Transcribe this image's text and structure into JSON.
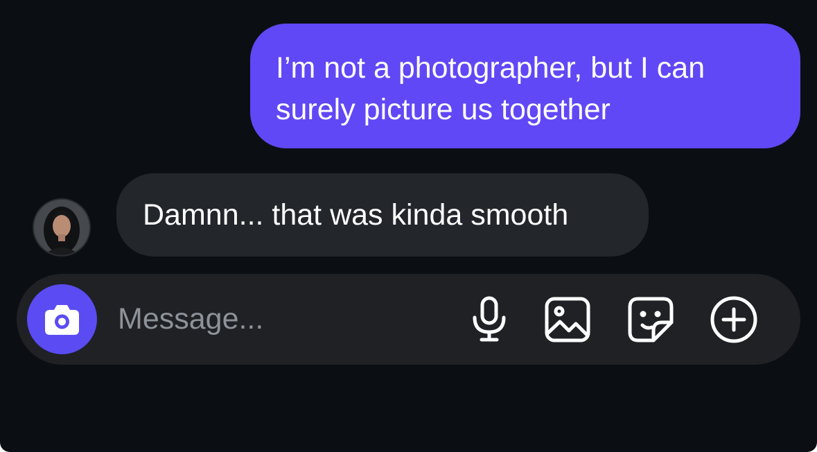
{
  "conversation": {
    "outgoing_message": {
      "line_1": "I’m not a photographer, but I can",
      "line_2": "surely picture us together"
    },
    "incoming_message": {
      "text": "Damnn... that was kinda smooth"
    }
  },
  "composer": {
    "placeholder": "Message...",
    "value": "",
    "icons": [
      "camera-icon",
      "microphone-icon",
      "gallery-icon",
      "sticker-icon",
      "plus-icon"
    ]
  },
  "colors": {
    "background": "#0b0f14",
    "outgoing_bubble": "#6048f6",
    "incoming_bubble": "#23262b",
    "composer": "#1f2125",
    "camera_button": "#5a4cf2",
    "placeholder": "#8e9299"
  }
}
